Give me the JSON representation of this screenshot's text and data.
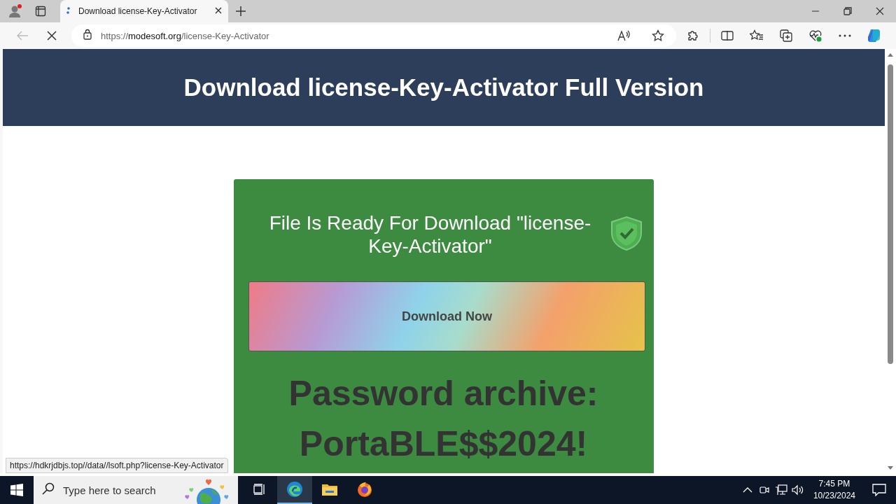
{
  "browser": {
    "tab": {
      "title": "Download license-Key-Activator",
      "selected": true
    },
    "address": {
      "scheme": "https://",
      "host": "modesoft.org",
      "path": "/license-Key-Activator"
    },
    "loading": true
  },
  "page": {
    "header_title": "Download license-Key-Activator Full Version",
    "card": {
      "title": "File Is Ready For Download \"license-Key-Activator\"",
      "button": "Download Now",
      "password_lines": [
        "Password archive:",
        "PortaBLE$$2024!"
      ]
    },
    "status_url": "https://hdkrjdbjs.top//data//lsoft.php?license-Key-Activator"
  },
  "taskbar": {
    "search_placeholder": "Type here to search",
    "apps": [
      {
        "kind": "taskview",
        "selected": false
      },
      {
        "kind": "edge",
        "selected": true
      },
      {
        "kind": "explorer",
        "selected": false
      },
      {
        "kind": "firefox",
        "selected": false
      }
    ],
    "time": "7:45 PM",
    "date": "10/23/2024"
  }
}
